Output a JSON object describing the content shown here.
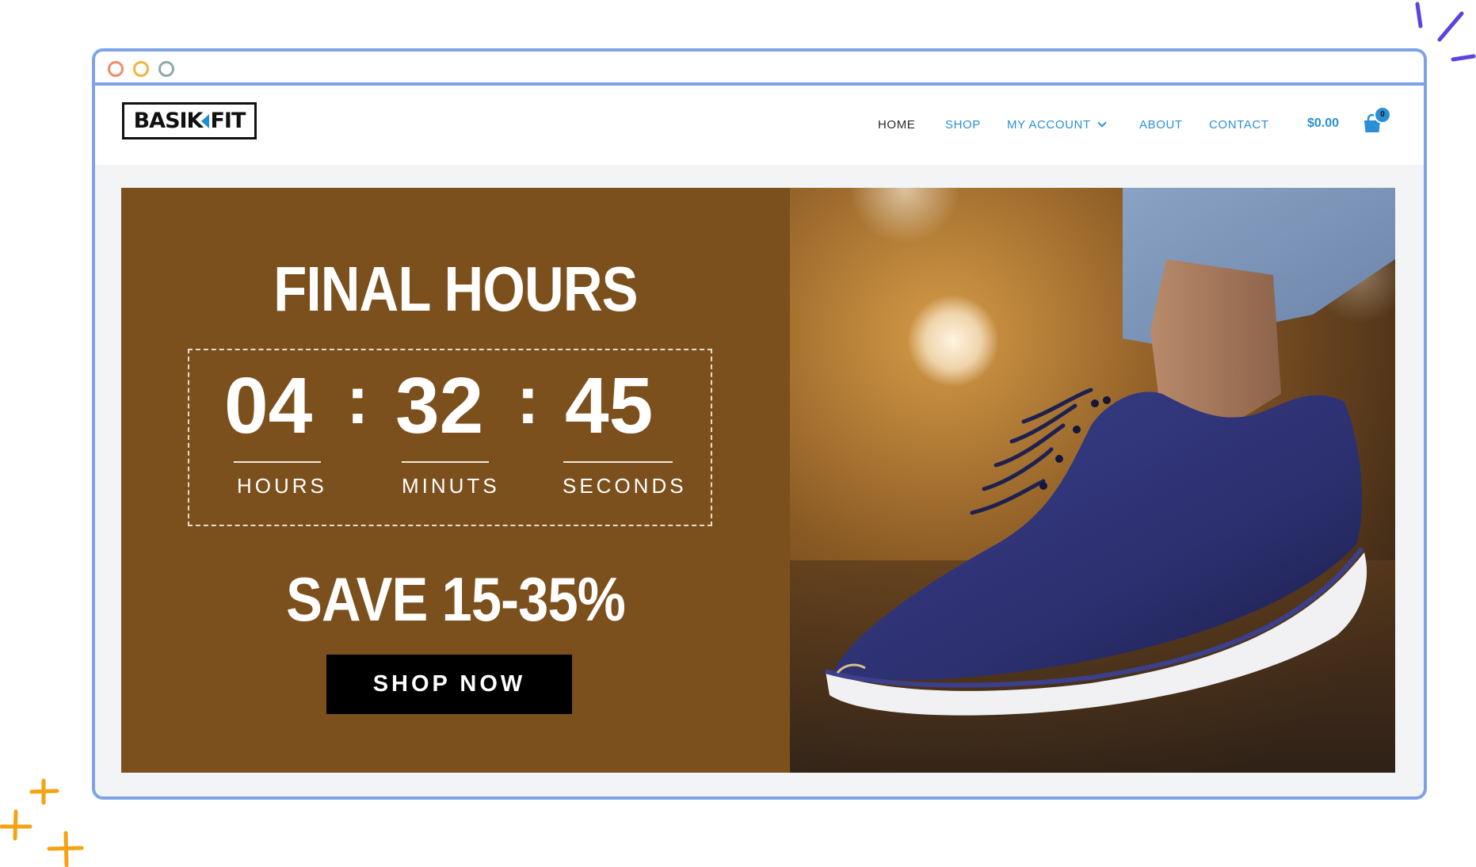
{
  "colors": {
    "frame": "#7ea2e6",
    "accent": "#2b8fd6",
    "hero_bg": "#7b501d",
    "button_bg": "#000000"
  },
  "logo": {
    "left_text": "BASIK",
    "right_text": "FIT"
  },
  "nav": {
    "items": [
      {
        "label": "HOME",
        "active": true
      },
      {
        "label": "SHOP"
      },
      {
        "label": "MY ACCOUNT",
        "has_dropdown": true
      },
      {
        "label": "ABOUT"
      },
      {
        "label": "CONTACT"
      }
    ]
  },
  "cart": {
    "total": "$0.00",
    "count": "0",
    "icon": "shopping-bag-icon"
  },
  "hero": {
    "title": "FINAL HOURS",
    "countdown": {
      "hours": "04",
      "minutes": "32",
      "seconds": "45",
      "separator": ":",
      "hours_label": "HOURS",
      "minutes_label": "MINUTS",
      "seconds_label": "SECONDS"
    },
    "promo": "SAVE 15-35%",
    "cta": "SHOP NOW"
  }
}
